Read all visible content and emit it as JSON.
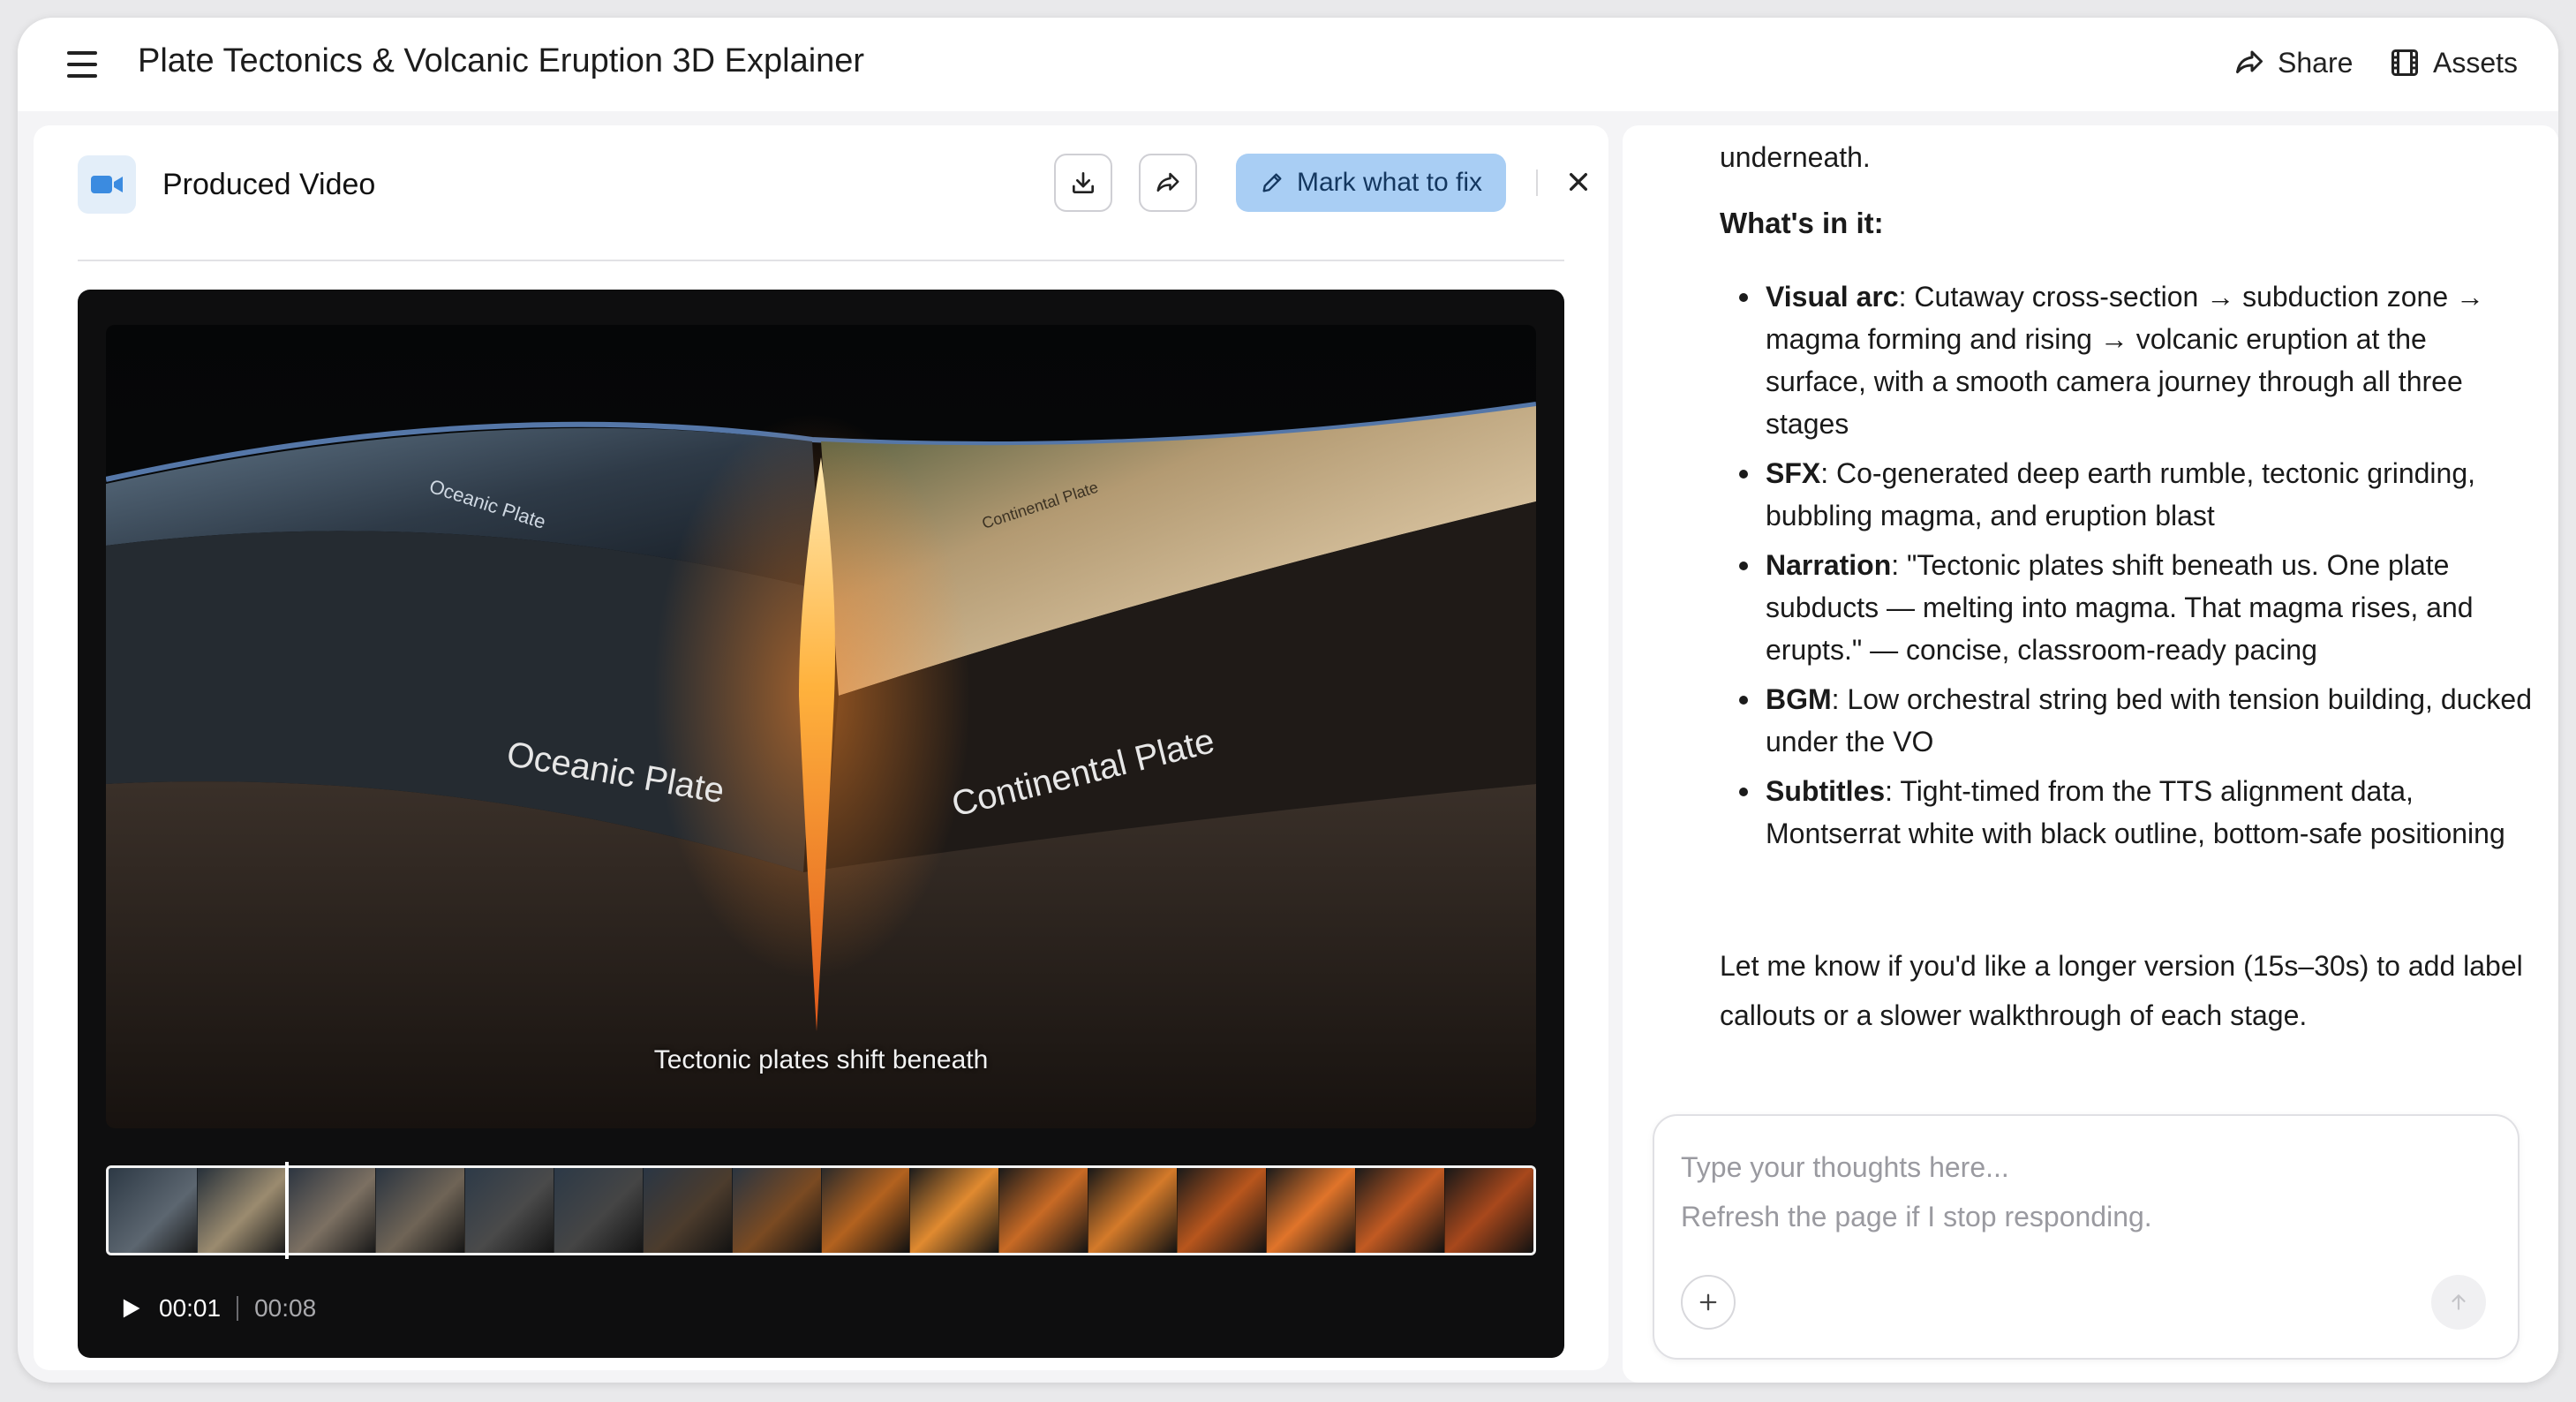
{
  "header": {
    "title": "Plate Tectonics & Volcanic Eruption 3D Explainer",
    "share_label": "Share",
    "assets_label": "Assets"
  },
  "video_panel": {
    "title": "Produced Video",
    "mark_label": "Mark what to fix",
    "frame_labels": {
      "oceanic_small": "Oceanic Plate",
      "continental_small": "Continental Plate",
      "oceanic_large": "Oceanic Plate",
      "continental_large": "Continental Plate"
    },
    "subtitle": "Tectonic plates shift beneath",
    "current_time": "00:01",
    "duration": "00:08",
    "progress": 0.125
  },
  "chat": {
    "cut_off_line": "underneath.",
    "section_heading": "What's in it:",
    "bullets": [
      {
        "label": "Visual arc",
        "text": ": Cutaway cross-section → subduction zone → magma forming and rising → volcanic eruption at the surface, with a smooth camera journey through all three stages"
      },
      {
        "label": "SFX",
        "text": ": Co-generated deep earth rumble, tectonic grinding, bubbling magma, and eruption blast"
      },
      {
        "label": "Narration",
        "text": ": \"Tectonic plates shift beneath us. One plate subducts — melting into magma. That magma rises, and erupts.\" — concise, classroom-ready pacing"
      },
      {
        "label": "BGM",
        "text": ": Low orchestral string bed with tension building, ducked under the VO"
      },
      {
        "label": "Subtitles",
        "text": ": Tight-timed from the TTS alignment data, Montserrat white with black outline, bottom-safe positioning"
      }
    ],
    "closing": "Let me know if you'd like a longer version (15s–30s) to add label callouts or a slower walkthrough of each stage."
  },
  "composer": {
    "placeholder": "Type your thoughts here...\nRefresh the page if I stop responding."
  },
  "colors": {
    "accent_button": "#a9cef4",
    "camera_badge": "#e3eef9",
    "camera_icon": "#3b8be0",
    "player_bg": "#0e0e0f"
  },
  "icons": [
    "menu-icon",
    "share-icon",
    "film-icon",
    "video-camera-icon",
    "download-icon",
    "share-arrow-icon",
    "pencil-icon",
    "close-icon",
    "play-icon",
    "plus-icon",
    "arrow-up-icon"
  ]
}
